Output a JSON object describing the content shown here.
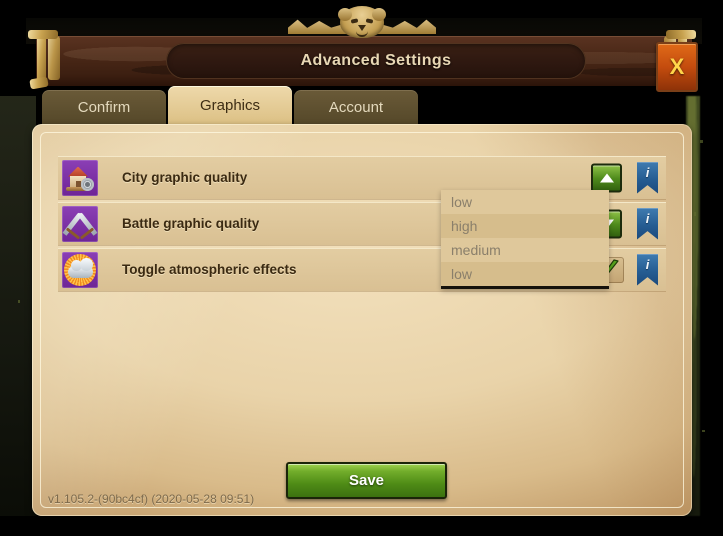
{
  "window": {
    "title": "Advanced Settings",
    "close_label": "X",
    "crest_icon": "lion-head-crest-icon"
  },
  "tabs": [
    {
      "label": "Confirm",
      "active": false,
      "name": "tab-confirm"
    },
    {
      "label": "Graphics",
      "active": true,
      "name": "tab-graphics"
    },
    {
      "label": "Account",
      "active": false,
      "name": "tab-account"
    }
  ],
  "settings": {
    "rows": [
      {
        "label": "City graphic quality",
        "icon": "city-house-gear-icon",
        "control": "stepper-up-button",
        "info": "i"
      },
      {
        "label": "Battle graphic quality",
        "icon": "crossed-swords-icon",
        "control": "stepper-down-button",
        "info": "i"
      },
      {
        "label": "Toggle atmospheric effects",
        "icon": "sun-cloud-icon",
        "control": "checkbox-checked",
        "info": "i"
      }
    ]
  },
  "dropdown": {
    "open": true,
    "selected": "low",
    "options": [
      "low",
      "high",
      "medium",
      "low"
    ]
  },
  "footer": {
    "save_label": "Save",
    "version": "v1.105.2-(90bc4cf) (2020-05-28 09:51)"
  },
  "colors": {
    "parchment": "#e9d3a9",
    "wood": "#4a2817",
    "tab_active": "#eed9ab",
    "tab_inactive": "#6a5a38",
    "green_button": "#4f8c16",
    "info_blue": "#255c92",
    "close_orange": "#c44c0e",
    "icon_purple": "#6e2596"
  }
}
